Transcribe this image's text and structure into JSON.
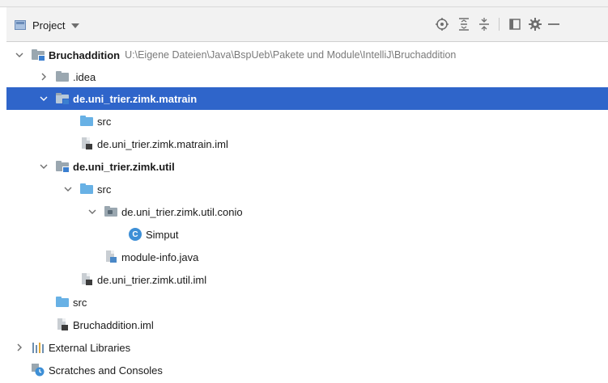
{
  "panel": {
    "title": "Project"
  },
  "toolbar_icons": [
    "locate-icon",
    "expand-all-icon",
    "collapse-all-icon",
    "layout-icon",
    "gear-icon",
    "hide-icon"
  ],
  "colors": {
    "selection": "#2f65ca",
    "source_folder": "#68b1e5",
    "plain_folder": "#9aa7b0",
    "path_text": "#7a7a7a"
  },
  "tree": {
    "root_name": "Bruchaddition",
    "root_path": "U:\\Eigene Dateien\\Java\\BspUeb\\Pakete und Module\\IntelliJ\\Bruchaddition",
    "idea": ".idea",
    "mod1": "de.uni_trier.zimk.matrain",
    "mod1_src": "src",
    "mod1_iml": "de.uni_trier.zimk.matrain.iml",
    "mod2": "de.uni_trier.zimk.util",
    "mod2_src": "src",
    "mod2_pkg": "de.uni_trier.zimk.util.conio",
    "mod2_class": "Simput",
    "mod2_class_badge": "C",
    "mod2_moduleinfo": "module-info.java",
    "mod2_iml": "de.uni_trier.zimk.util.iml",
    "root_src": "src",
    "root_iml": "Bruchaddition.iml",
    "ext_libs": "External Libraries",
    "scratches": "Scratches and Consoles"
  }
}
